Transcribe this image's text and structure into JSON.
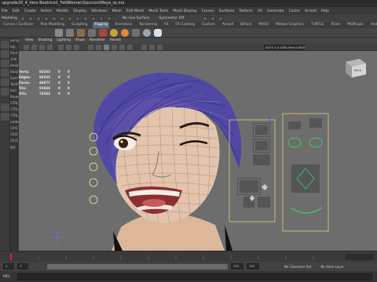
{
  "window": {
    "title": "upgrade20_4_Vero Beatrice1_FeltWoman\\Sources\\Maya_rp.ma"
  },
  "menubar": {
    "items": [
      "File",
      "Edit",
      "Create",
      "Select",
      "Modify",
      "Display",
      "Windows",
      "Mesh",
      "Edit Mesh",
      "Mesh Tools",
      "Mesh Display",
      "Curves",
      "Surfaces",
      "Deform",
      "UV",
      "Generate",
      "Cache",
      "Arnold",
      "Help"
    ]
  },
  "statusline": {
    "mode_text": "Modeling",
    "no_live_surface": "No Live Surface",
    "symmetry": "Symmetry: Off"
  },
  "shelf": {
    "tabs": [
      "Curves / Surfaces",
      "Poly Modeling",
      "Sculpting",
      "Rigging",
      "Animation",
      "Rendering",
      "FX",
      "FX Caching",
      "Custom",
      "Arnold",
      "Bifrost",
      "MASH",
      "Motion Graphics",
      "TURTLE",
      "XGen",
      "MGPlugin",
      "test"
    ],
    "active_index": 3
  },
  "viewport": {
    "menu_items": [
      "View",
      "Shading",
      "Lighting",
      "Show",
      "Renderer",
      "Panels"
    ],
    "colorspace": "ACES 1.0 SDR-video (sRGB)"
  },
  "hud": {
    "rows": [
      {
        "label": "Verts:",
        "total": "66203",
        "sel1": "0",
        "sel2": "0"
      },
      {
        "label": "Edges:",
        "total": "98535",
        "sel1": "0",
        "sel2": "0"
      },
      {
        "label": "Faces:",
        "total": "46677",
        "sel1": "0",
        "sel2": "0"
      },
      {
        "label": "Tris:",
        "total": "91936",
        "sel1": "0",
        "sel2": "0"
      },
      {
        "label": "UVs:",
        "total": "74563",
        "sel1": "0",
        "sel2": "0"
      }
    ]
  },
  "viewcube": {
    "label": "BACK"
  },
  "outliner": {
    "items": [
      "persp",
      "top",
      "front",
      "side",
      "Head",
      "Body",
      "Eyes",
      "Teeth",
      "Hair",
      "Brows",
      "CTRL_F",
      "CTRL_L",
      "CTRL_R",
      "Lashes",
      "Ctrl1",
      "Ctrl2",
      "Ctrl3",
      "grp"
    ]
  },
  "rangebar": {
    "start": "1",
    "end": "120",
    "no_character_set": "No Character Set",
    "no_anim_layer": "No Anim Layer"
  },
  "cmdbar": {
    "label": "MEL"
  }
}
